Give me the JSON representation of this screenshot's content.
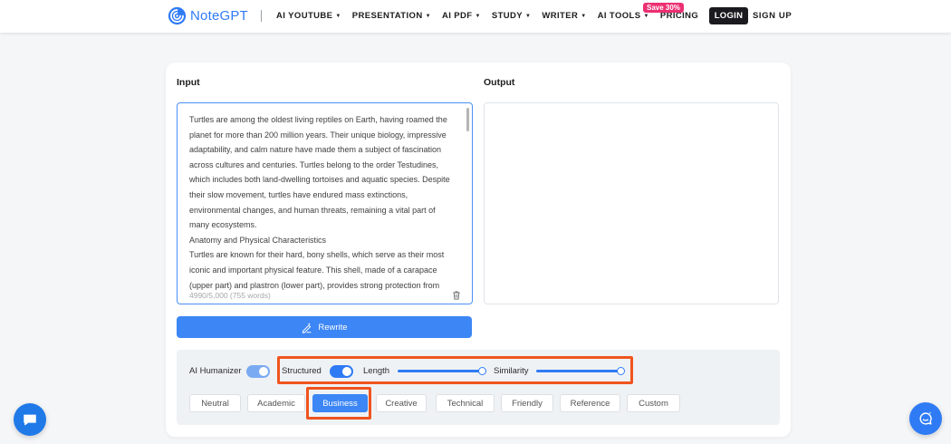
{
  "header": {
    "logo_text": "NoteGPT",
    "nav": [
      {
        "label": "AI YOUTUBE",
        "has_caret": true
      },
      {
        "label": "PRESENTATION",
        "has_caret": true
      },
      {
        "label": "AI PDF",
        "has_caret": true
      },
      {
        "label": "STUDY",
        "has_caret": true
      },
      {
        "label": "WRITER",
        "has_caret": true
      },
      {
        "label": "AI TOOLS",
        "has_caret": true
      },
      {
        "label": "PRICING",
        "has_caret": false
      }
    ],
    "pricing_badge": "Save 30%",
    "login_label": "LOGIN",
    "signup_label": "SIGN UP",
    "brand_color": "#2f7bf5",
    "badge_color": "#ec2f72"
  },
  "editor": {
    "input_label": "Input",
    "output_label": "Output",
    "input_paragraphs": [
      "Turtles are among the oldest living reptiles on Earth, having roamed the planet for more than 200 million years. Their unique biology, impressive adaptability, and calm nature have made them a subject of fascination across cultures and centuries. Turtles belong to the order Testudines, which includes both land-dwelling tortoises and aquatic species. Despite their slow movement, turtles have endured mass extinctions, environmental changes, and human threats, remaining a vital part of many ecosystems.",
      "Anatomy and Physical Characteristics",
      "Turtles are known for their hard, bony shells, which serve as their most iconic and important physical feature. This shell, made of a carapace (upper part) and plastron (lower part), provides strong protection from"
    ],
    "counter": "4990/5,000 (755 words)",
    "output_text": "",
    "rewrite_label": "Rewrite",
    "trash_icon": "trash-icon"
  },
  "options": {
    "ai_humanizer": {
      "label": "AI Humanizer",
      "on": true
    },
    "structured": {
      "label": "Structured",
      "on": true
    },
    "length": {
      "label": "Length",
      "value": 1.0
    },
    "similarity": {
      "label": "Similarity",
      "value": 1.0
    },
    "tones": [
      "Neutral",
      "Academic",
      "Business",
      "Creative",
      "Technical",
      "Friendly",
      "Reference",
      "Custom"
    ],
    "selected_tone": "Business",
    "highlight_color": "#f0541e"
  },
  "floating": {
    "left_icon": "chat-bubble-icon",
    "right_icon": "assistant-chat-icon"
  }
}
